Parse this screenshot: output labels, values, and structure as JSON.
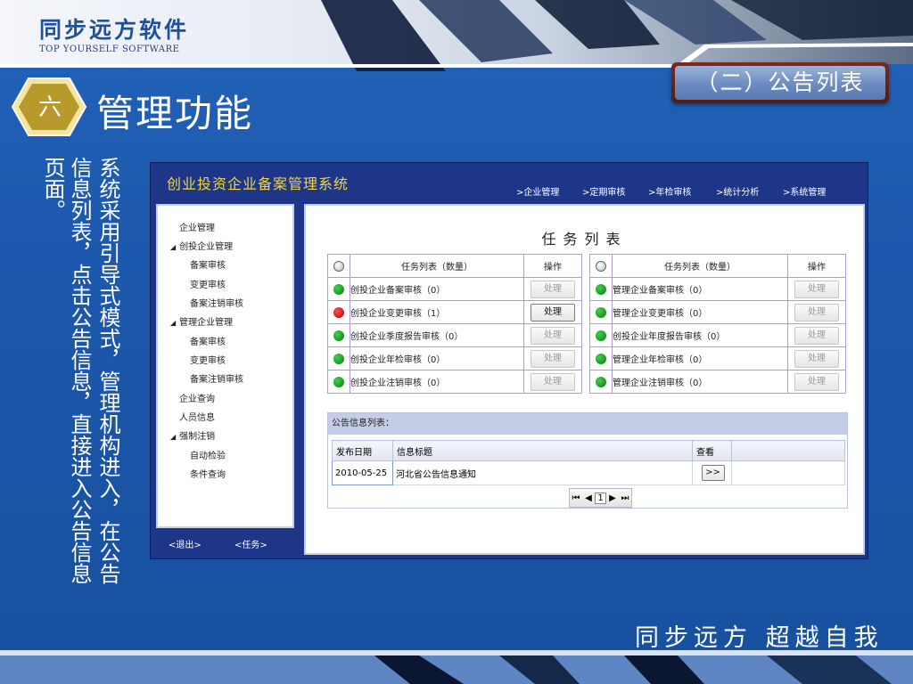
{
  "brand": {
    "name_cn": "同步远方软件",
    "name_en": "TOP YOURSELF SOFTWARE"
  },
  "section": {
    "number": "六",
    "title": "管理功能",
    "subtitle": "（二）公告列表"
  },
  "description": {
    "line1": "系统采用引导式模式，管理机构进入，在公告",
    "line2": "信息列表，点击公告信息，直接进入公告信息",
    "line3": "页面。"
  },
  "slogan": "同步远方 超越自我",
  "app": {
    "title": "创业投资企业备案管理系统",
    "nav": [
      ">企业管理",
      ">定期审核",
      ">年检审核",
      ">统计分析",
      ">系统管理"
    ],
    "sidebar": {
      "items": [
        {
          "label": "企业管理"
        },
        {
          "label": "创投企业管理",
          "caret": "◢"
        },
        {
          "label": "备案审核"
        },
        {
          "label": "变更审核"
        },
        {
          "label": "备案注销审核"
        },
        {
          "label": "管理企业管理",
          "caret": "◢"
        },
        {
          "label": "备案审核"
        },
        {
          "label": "变更审核"
        },
        {
          "label": "备案注销审核"
        },
        {
          "label": "企业查询"
        },
        {
          "label": "人员信息"
        },
        {
          "label": "强制注销",
          "caret": "◢"
        },
        {
          "label": "自动检验"
        },
        {
          "label": "条件查询"
        }
      ]
    },
    "footer_links": {
      "logout": "<退出>",
      "tasks": "<任务>"
    },
    "task_panel": {
      "title": "任务列表",
      "header": {
        "list": "任务列表（数量）",
        "op": "操作"
      },
      "left_rows": [
        {
          "label": "创投企业备案审核（0）",
          "status": "green",
          "button": "处理",
          "active": false
        },
        {
          "label": "创投企业变更审核（1）",
          "status": "red",
          "button": "处理",
          "active": true
        },
        {
          "label": "创投企业季度报告审核（0）",
          "status": "green",
          "button": "处理",
          "active": false
        },
        {
          "label": "创投企业年检审核（0）",
          "status": "green",
          "button": "处理",
          "active": false
        },
        {
          "label": "创投企业注销审核（0）",
          "status": "green",
          "button": "处理",
          "active": false
        }
      ],
      "right_rows": [
        {
          "label": "管理企业备案审核（0）",
          "status": "green",
          "button": "处理",
          "active": false
        },
        {
          "label": "管理企业变更审核（0）",
          "status": "green",
          "button": "处理",
          "active": false
        },
        {
          "label": "创投企业年度报告审核（0）",
          "status": "green",
          "button": "处理",
          "active": false
        },
        {
          "label": "管理企业年检审核（0）",
          "status": "green",
          "button": "处理",
          "active": false
        },
        {
          "label": "管理企业注销审核（0）",
          "status": "green",
          "button": "处理",
          "active": false
        }
      ]
    },
    "notice": {
      "heading": "公告信息列表：",
      "columns": [
        "发布日期",
        "信息标题",
        "查看"
      ],
      "rows": [
        {
          "date": "2010-05-25",
          "title": "河北省公告信息通知",
          "view": ">>"
        }
      ],
      "pager": {
        "first": "⏮",
        "prev": "◀",
        "page": "1",
        "next": "▶",
        "last": "⏭"
      }
    }
  }
}
